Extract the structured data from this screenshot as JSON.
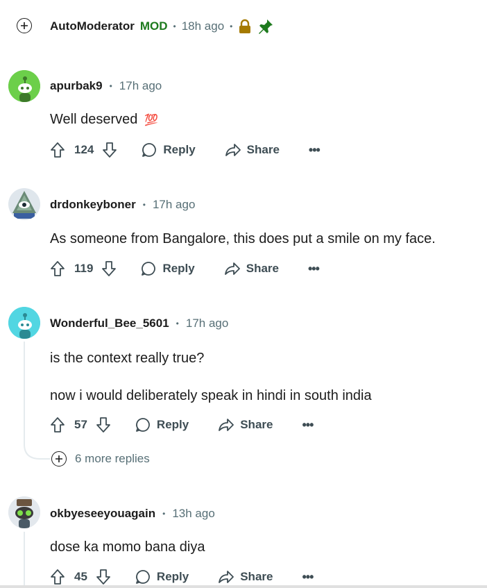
{
  "automod": {
    "author": "AutoModerator",
    "badge": "MOD",
    "time": "18h ago",
    "icons": [
      "expand-icon",
      "lock-icon",
      "pin-icon"
    ],
    "colors": {
      "lock": "#a57a00",
      "pin": "#1d7a1d",
      "mod": "#1d7a1d"
    }
  },
  "comments": [
    {
      "author": "apurbak9",
      "time": "17h ago",
      "lines": [
        "Well deserved"
      ],
      "emoji": "💯",
      "votes": "124",
      "reply_label": "Reply",
      "share_label": "Share",
      "avatar": "green-snoo-avatar"
    },
    {
      "author": "drdonkeyboner",
      "time": "17h ago",
      "lines": [
        "As someone from Bangalore, this does put a smile on my face."
      ],
      "votes": "119",
      "reply_label": "Reply",
      "share_label": "Share",
      "avatar": "eye-pyramid-avatar"
    },
    {
      "author": "Wonderful_Bee_5601",
      "time": "17h ago",
      "lines": [
        "is the context really true?",
        "now i would deliberately speak in hindi in south india"
      ],
      "votes": "57",
      "reply_label": "Reply",
      "share_label": "Share",
      "more_replies": "6 more replies",
      "avatar": "cyan-snoo-avatar"
    },
    {
      "author": "okbyeseeyouagain",
      "time": "13h ago",
      "lines": [
        "dose ka momo bana diya"
      ],
      "votes": "45",
      "reply_label": "Reply",
      "share_label": "Share",
      "avatar": "snoo-goggles-avatar"
    }
  ]
}
